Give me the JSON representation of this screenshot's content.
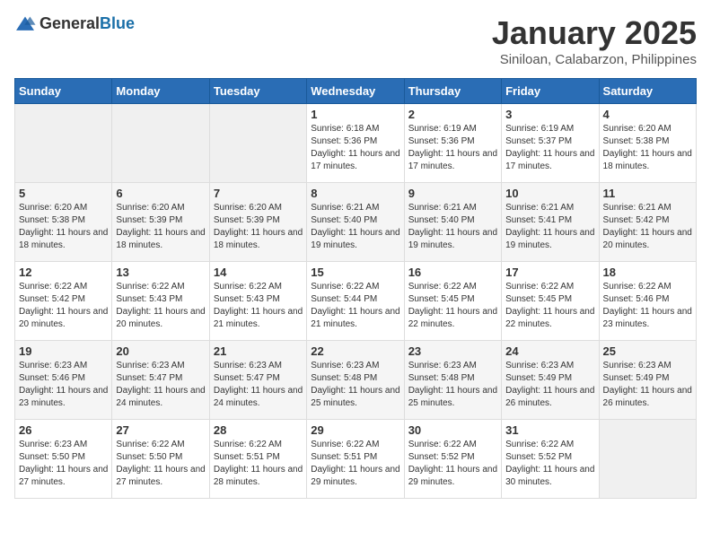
{
  "header": {
    "logo_general": "General",
    "logo_blue": "Blue",
    "title": "January 2025",
    "subtitle": "Siniloan, Calabarzon, Philippines"
  },
  "weekdays": [
    "Sunday",
    "Monday",
    "Tuesday",
    "Wednesday",
    "Thursday",
    "Friday",
    "Saturday"
  ],
  "weeks": [
    [
      {
        "day": "",
        "empty": true
      },
      {
        "day": "",
        "empty": true
      },
      {
        "day": "",
        "empty": true
      },
      {
        "day": "1",
        "sunrise": "6:18 AM",
        "sunset": "5:36 PM",
        "daylight": "11 hours and 17 minutes."
      },
      {
        "day": "2",
        "sunrise": "6:19 AM",
        "sunset": "5:36 PM",
        "daylight": "11 hours and 17 minutes."
      },
      {
        "day": "3",
        "sunrise": "6:19 AM",
        "sunset": "5:37 PM",
        "daylight": "11 hours and 17 minutes."
      },
      {
        "day": "4",
        "sunrise": "6:20 AM",
        "sunset": "5:38 PM",
        "daylight": "11 hours and 18 minutes."
      }
    ],
    [
      {
        "day": "5",
        "sunrise": "6:20 AM",
        "sunset": "5:38 PM",
        "daylight": "11 hours and 18 minutes."
      },
      {
        "day": "6",
        "sunrise": "6:20 AM",
        "sunset": "5:39 PM",
        "daylight": "11 hours and 18 minutes."
      },
      {
        "day": "7",
        "sunrise": "6:20 AM",
        "sunset": "5:39 PM",
        "daylight": "11 hours and 18 minutes."
      },
      {
        "day": "8",
        "sunrise": "6:21 AM",
        "sunset": "5:40 PM",
        "daylight": "11 hours and 19 minutes."
      },
      {
        "day": "9",
        "sunrise": "6:21 AM",
        "sunset": "5:40 PM",
        "daylight": "11 hours and 19 minutes."
      },
      {
        "day": "10",
        "sunrise": "6:21 AM",
        "sunset": "5:41 PM",
        "daylight": "11 hours and 19 minutes."
      },
      {
        "day": "11",
        "sunrise": "6:21 AM",
        "sunset": "5:42 PM",
        "daylight": "11 hours and 20 minutes."
      }
    ],
    [
      {
        "day": "12",
        "sunrise": "6:22 AM",
        "sunset": "5:42 PM",
        "daylight": "11 hours and 20 minutes."
      },
      {
        "day": "13",
        "sunrise": "6:22 AM",
        "sunset": "5:43 PM",
        "daylight": "11 hours and 20 minutes."
      },
      {
        "day": "14",
        "sunrise": "6:22 AM",
        "sunset": "5:43 PM",
        "daylight": "11 hours and 21 minutes."
      },
      {
        "day": "15",
        "sunrise": "6:22 AM",
        "sunset": "5:44 PM",
        "daylight": "11 hours and 21 minutes."
      },
      {
        "day": "16",
        "sunrise": "6:22 AM",
        "sunset": "5:45 PM",
        "daylight": "11 hours and 22 minutes."
      },
      {
        "day": "17",
        "sunrise": "6:22 AM",
        "sunset": "5:45 PM",
        "daylight": "11 hours and 22 minutes."
      },
      {
        "day": "18",
        "sunrise": "6:22 AM",
        "sunset": "5:46 PM",
        "daylight": "11 hours and 23 minutes."
      }
    ],
    [
      {
        "day": "19",
        "sunrise": "6:23 AM",
        "sunset": "5:46 PM",
        "daylight": "11 hours and 23 minutes."
      },
      {
        "day": "20",
        "sunrise": "6:23 AM",
        "sunset": "5:47 PM",
        "daylight": "11 hours and 24 minutes."
      },
      {
        "day": "21",
        "sunrise": "6:23 AM",
        "sunset": "5:47 PM",
        "daylight": "11 hours and 24 minutes."
      },
      {
        "day": "22",
        "sunrise": "6:23 AM",
        "sunset": "5:48 PM",
        "daylight": "11 hours and 25 minutes."
      },
      {
        "day": "23",
        "sunrise": "6:23 AM",
        "sunset": "5:48 PM",
        "daylight": "11 hours and 25 minutes."
      },
      {
        "day": "24",
        "sunrise": "6:23 AM",
        "sunset": "5:49 PM",
        "daylight": "11 hours and 26 minutes."
      },
      {
        "day": "25",
        "sunrise": "6:23 AM",
        "sunset": "5:49 PM",
        "daylight": "11 hours and 26 minutes."
      }
    ],
    [
      {
        "day": "26",
        "sunrise": "6:23 AM",
        "sunset": "5:50 PM",
        "daylight": "11 hours and 27 minutes."
      },
      {
        "day": "27",
        "sunrise": "6:22 AM",
        "sunset": "5:50 PM",
        "daylight": "11 hours and 27 minutes."
      },
      {
        "day": "28",
        "sunrise": "6:22 AM",
        "sunset": "5:51 PM",
        "daylight": "11 hours and 28 minutes."
      },
      {
        "day": "29",
        "sunrise": "6:22 AM",
        "sunset": "5:51 PM",
        "daylight": "11 hours and 29 minutes."
      },
      {
        "day": "30",
        "sunrise": "6:22 AM",
        "sunset": "5:52 PM",
        "daylight": "11 hours and 29 minutes."
      },
      {
        "day": "31",
        "sunrise": "6:22 AM",
        "sunset": "5:52 PM",
        "daylight": "11 hours and 30 minutes."
      },
      {
        "day": "",
        "empty": true
      }
    ]
  ],
  "labels": {
    "sunrise": "Sunrise:",
    "sunset": "Sunset:",
    "daylight": "Daylight:"
  }
}
